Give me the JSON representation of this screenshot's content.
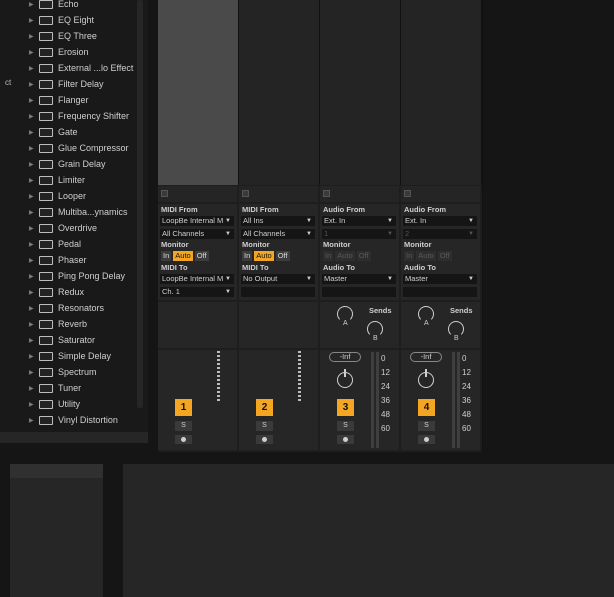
{
  "browser": {
    "side_label": "ct",
    "items": [
      "Echo",
      "EQ Eight",
      "EQ Three",
      "Erosion",
      "External ...lo Effect",
      "Filter Delay",
      "Flanger",
      "Frequency Shifter",
      "Gate",
      "Glue Compressor",
      "Grain Delay",
      "Limiter",
      "Looper",
      "Multiba...ynamics",
      "Overdrive",
      "Pedal",
      "Phaser",
      "Ping Pong Delay",
      "Redux",
      "Resonators",
      "Reverb",
      "Saturator",
      "Simple Delay",
      "Spectrum",
      "Tuner",
      "Utility",
      "Vinyl Distortion"
    ]
  },
  "tracks": [
    {
      "number": "1",
      "from_label": "MIDI From",
      "from_value": "LoopBe Internal M",
      "channel": "All Channels",
      "monitor_label": "Monitor",
      "monitor": [
        "In",
        "Auto",
        "Off"
      ],
      "monitor_active": "Auto",
      "to_label": "MIDI To",
      "to_value": "LoopBe Internal M",
      "to_channel": "Ch. 1",
      "solo": "S"
    },
    {
      "number": "2",
      "from_label": "MIDI From",
      "from_value": "All Ins",
      "channel": "All Channels",
      "monitor_label": "Monitor",
      "monitor": [
        "In",
        "Auto",
        "Off"
      ],
      "monitor_active": "Auto",
      "to_label": "MIDI To",
      "to_value": "No Output",
      "to_channel": "",
      "solo": "S"
    },
    {
      "number": "3",
      "from_label": "Audio From",
      "from_value": "Ext. In",
      "channel": "1",
      "monitor_label": "Monitor",
      "monitor": [
        "In",
        "Auto",
        "Off"
      ],
      "monitor_active": "",
      "to_label": "Audio To",
      "to_value": "Master",
      "to_channel": "",
      "solo": "S",
      "sends_label": "Sends",
      "send_a": "A",
      "send_b": "B",
      "volume": "-Inf",
      "scale": [
        "0",
        "12",
        "24",
        "36",
        "48",
        "60"
      ]
    },
    {
      "number": "4",
      "from_label": "Audio From",
      "from_value": "Ext. In",
      "channel": "2",
      "monitor_label": "Monitor",
      "monitor": [
        "In",
        "Auto",
        "Off"
      ],
      "monitor_active": "",
      "to_label": "Audio To",
      "to_value": "Master",
      "to_channel": "",
      "solo": "S",
      "sends_label": "Sends",
      "send_a": "A",
      "send_b": "B",
      "volume": "-Inf",
      "scale": [
        "0",
        "12",
        "24",
        "36",
        "48",
        "60"
      ]
    }
  ],
  "colors": {
    "accent": "#f4a623",
    "panel": "#262626",
    "background": "#151515"
  }
}
